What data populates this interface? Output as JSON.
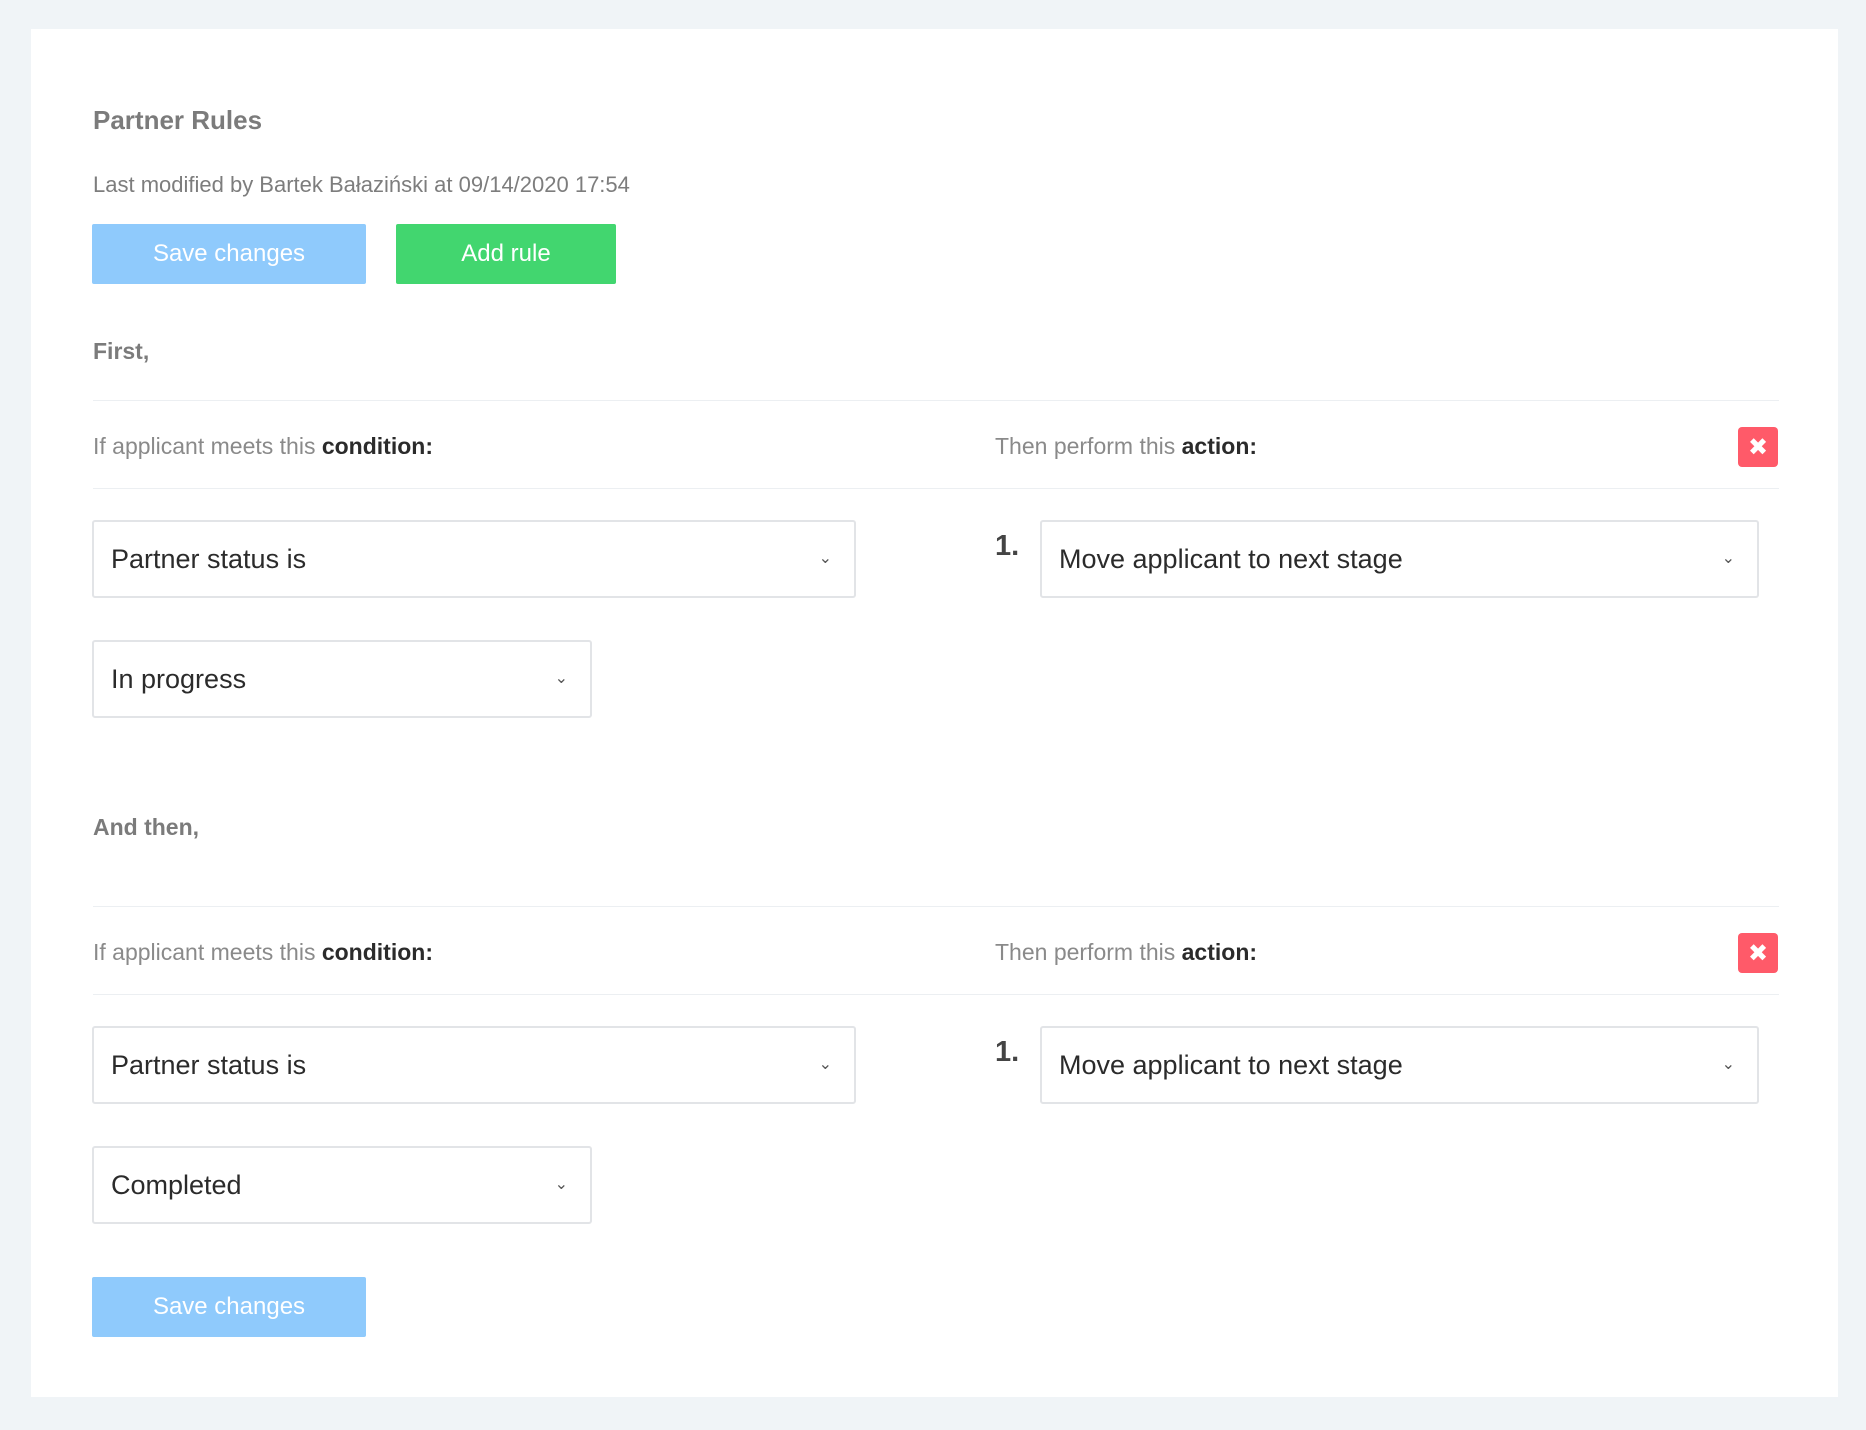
{
  "page": {
    "title": "Partner Rules",
    "last_modified": "Last modified by Bartek Bałaziński at 09/14/2020 17:54",
    "save_label": "Save changes",
    "add_rule_label": "Add rule"
  },
  "colors": {
    "save_button": "#8fcafc",
    "add_button": "#42d66f",
    "delete_button": "#ff5a69",
    "background": "#f0f4f7"
  },
  "rules": [
    {
      "label": "First,",
      "condition_prefix": "If applicant meets this ",
      "condition_bold": "condition:",
      "action_prefix": "Then perform this ",
      "action_bold": "action:",
      "delete_icon": "close-icon",
      "condition_value": "Partner status is",
      "status_value": "In progress",
      "action_number": "1.",
      "action_value": "Move applicant to next stage"
    },
    {
      "label": "And then,",
      "condition_prefix": "If applicant meets this ",
      "condition_bold": "condition:",
      "action_prefix": "Then perform this ",
      "action_bold": "action:",
      "delete_icon": "close-icon",
      "condition_value": "Partner status is",
      "status_value": "Completed",
      "action_number": "1.",
      "action_value": "Move applicant to next stage"
    }
  ],
  "icons": {
    "dropdown": "chevron-down-icon",
    "delete": "close-icon"
  }
}
